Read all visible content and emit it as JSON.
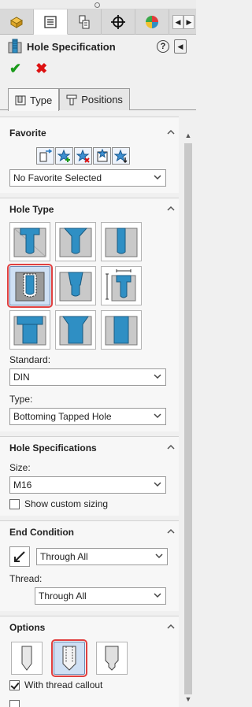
{
  "manager_tabs": [
    {
      "icon": "feature-manager-icon"
    },
    {
      "icon": "property-manager-icon"
    },
    {
      "icon": "configuration-manager-icon"
    },
    {
      "icon": "dimxpert-manager-icon"
    },
    {
      "icon": "display-manager-icon"
    }
  ],
  "header": {
    "title": "Hole Specification",
    "help_icon": "help-icon",
    "collapse_icon": "collapse-icon"
  },
  "actions": {
    "ok": "✔",
    "cancel": "✖"
  },
  "tabs": [
    {
      "label": "Type",
      "active": true
    },
    {
      "label": "Positions",
      "active": false
    }
  ],
  "favorite": {
    "title": "Favorite",
    "buttons": [
      "apply-defaults-icon",
      "add-favorite-icon",
      "delete-favorite-icon",
      "save-favorite-icon",
      "load-favorite-icon"
    ],
    "selected": "No Favorite Selected"
  },
  "hole_type": {
    "title": "Hole Type",
    "types": [
      "counterbore",
      "countersink",
      "hole",
      "straight-tap",
      "tapered-tap",
      "legacy-hole",
      "counterbore-slot",
      "countersink-slot",
      "slot"
    ],
    "selected_index": 3,
    "standard_label": "Standard:",
    "standard_value": "DIN",
    "type_label": "Type:",
    "type_value": "Bottoming Tapped Hole"
  },
  "hole_specs": {
    "title": "Hole Specifications",
    "size_label": "Size:",
    "size_value": "M16",
    "custom_sizing_label": "Show custom sizing",
    "custom_sizing_checked": false
  },
  "end_condition": {
    "title": "End Condition",
    "value": "Through All",
    "thread_label": "Thread:",
    "thread_value": "Through All"
  },
  "options": {
    "title": "Options",
    "buttons": [
      "tap-drill-diameter",
      "cosmetic-thread",
      "remove-thread"
    ],
    "selected_index": 1,
    "thread_callout_label": "With thread callout",
    "thread_callout_checked": true
  },
  "colors": {
    "accent": "#e04040",
    "ok": "#1a9a1a",
    "cancel": "#dd1111",
    "selection": "#cfe0f4",
    "hole_blue": "#2f8fc4"
  }
}
